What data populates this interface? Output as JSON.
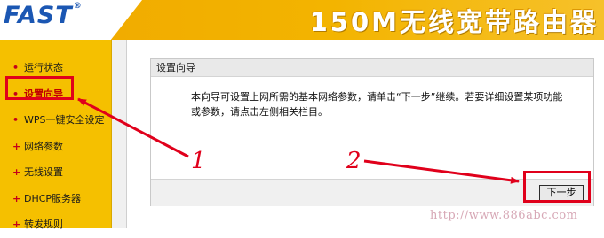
{
  "header": {
    "logo": "FAST",
    "logo_mark": "®",
    "product_title": "150M无线宽带路由器"
  },
  "sidebar": {
    "items": [
      {
        "label": "运行状态",
        "bullet": "•"
      },
      {
        "label": "设置向导",
        "bullet": "•",
        "active": true
      },
      {
        "label": "WPS一键安全设定",
        "bullet": "•"
      },
      {
        "label": "网络参数",
        "bullet": "+"
      },
      {
        "label": "无线设置",
        "bullet": "+"
      },
      {
        "label": "DHCP服务器",
        "bullet": "+"
      },
      {
        "label": "转发规则",
        "bullet": "+"
      }
    ]
  },
  "main": {
    "panel_title": "设置向导",
    "description": "本向导可设置上网所需的基本网络参数，请单击“下一步”继续。若要详细设置某项功能或参数，请点击左侧相关栏目。",
    "next_label": "下一步"
  },
  "annotations": {
    "step1": "1",
    "step2": "2",
    "color": "#e0001b"
  },
  "watermark": "http://www.886abc.com",
  "colors": {
    "header": "#f3b400",
    "sidebar": "#f5c000",
    "logo": "#1b57b3",
    "highlight": "#e0001b"
  }
}
